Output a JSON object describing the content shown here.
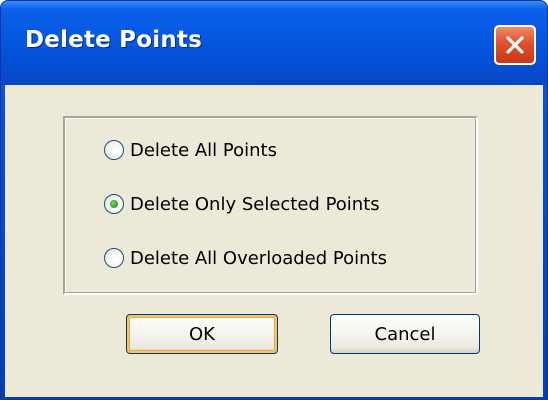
{
  "window": {
    "title": "Delete Points",
    "close_icon": "close-icon"
  },
  "options": [
    {
      "label": "Delete All  Points",
      "selected": false
    },
    {
      "label": "Delete Only Selected Points",
      "selected": true
    },
    {
      "label": "Delete All Overloaded Points",
      "selected": false
    }
  ],
  "buttons": {
    "ok_label": "OK",
    "cancel_label": "Cancel"
  },
  "colors": {
    "titlebar": "#0558e0",
    "client_background": "#ece9d8",
    "close_button": "#e0502a",
    "radio_selected": "#2fa62a"
  }
}
